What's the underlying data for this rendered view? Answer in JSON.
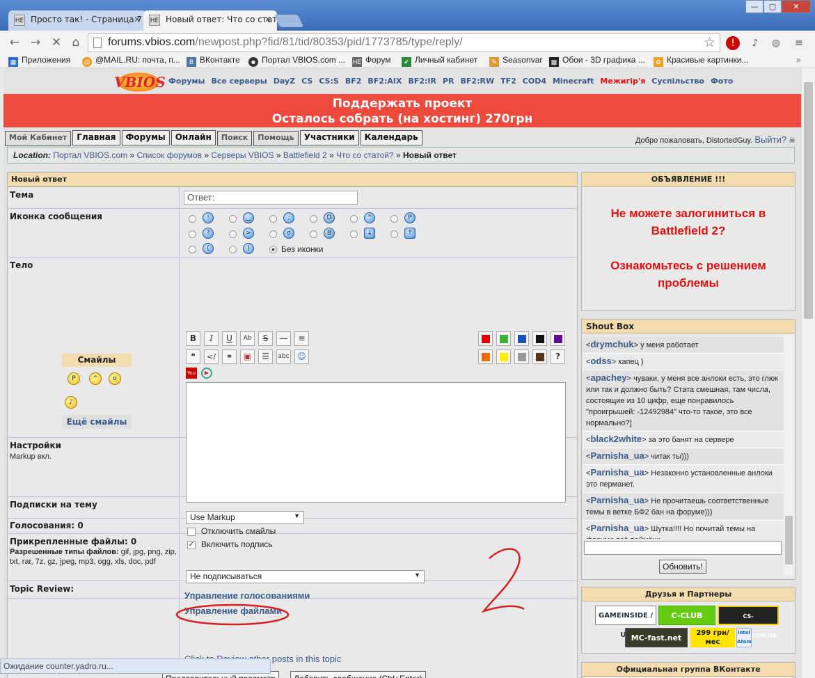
{
  "browser": {
    "tabs": [
      {
        "label": "Просто так! - Страница 7",
        "favicon": "НЕ"
      },
      {
        "label": "Новый ответ: Что со стат",
        "favicon": "НЕ"
      }
    ],
    "url_host": "forums.vbios.com",
    "url_path": "/newpost.php?fid/81/tid/80353/pid/1773785/type/reply/",
    "bookmarks": [
      "Приложения",
      "@MAIL.RU: почта, п...",
      "ВКонтакте",
      "Портал VBIOS.com ...",
      "Форум",
      "Личный кабинет",
      "Seasonvar",
      "Обои - 3D графика ...",
      "Красивые картинки..."
    ],
    "status": "Ожидание counter.yadro.ru..."
  },
  "site": {
    "logo": "VBIOS",
    "nav": [
      "Форумы",
      "Все серверы",
      "DayZ",
      "CS",
      "CS:S",
      "BF2",
      "BF2:AIX",
      "BF2:IR",
      "PR",
      "BF2:RW",
      "TF2",
      "COD4",
      "Minecraft",
      "Межигір'я",
      "Суспільство",
      "Фото"
    ],
    "banner_line1": "Поддержать проект",
    "banner_line2": "Осталось собрать (на хостинг) 270грн",
    "main_nav": [
      "Мой Кабинет",
      "Главная",
      "Форумы",
      "Онлайн",
      "Поиск",
      "Помощь",
      "Участники",
      "Календарь"
    ],
    "welcome": "Добро пожаловать, DistortedGuy.",
    "logout": "Выйти?",
    "location_label": "Location:",
    "crumbs": [
      "Портал VBIOS.com",
      "Список форумов",
      "Серверы VBIOS",
      "Battlefield 2",
      "Что со статой?"
    ],
    "crumb_current": "Новый ответ"
  },
  "form": {
    "header": "Новый ответ",
    "subject_label": "Тема",
    "subject_value": "Ответ:",
    "icon_label": "Иконка сообщения",
    "no_icon": "Без иконки",
    "body_label": "Тело",
    "smiles_title": "Смайлы",
    "more_smiles": "Ещё смайлы",
    "settings_label": "Настройки",
    "markup_on": "Markup вкл.",
    "markup_select": "Use Markup",
    "disable_smiles": "Отключить смайлы",
    "enable_signature": "Включить подпись",
    "subscribe_label": "Подписки на тему",
    "subscribe_select": "Не подписываться",
    "polls_label": "Голосования: 0",
    "polls_link": "Управление голосованиями",
    "files_label": "Прикрепленные файлы: 0",
    "files_types_label": "Разрешенные типы файлов:",
    "files_types": "gif, jpg, png, zip, txt, rar, 7z, gz, jpeg, mp3, ogg, xls, doc, pdf",
    "files_link": "Управление файлами",
    "review_label": "Topic Review:",
    "review_link": "Click to Review other posts in this topic",
    "preview_button": "Предварительный просмотр",
    "submit_button": "Добавить сообщение (Ctrl+Enter)",
    "colors": [
      "#e00000",
      "#3cb034",
      "#1e4fb8",
      "#111111",
      "#5a1090",
      "#f06a00",
      "#ffee00",
      "#999999",
      "#5a3416"
    ],
    "annotation": "2"
  },
  "announcement": {
    "title": "ОБЪЯВЛЕНИЕ !!!",
    "line1": "Не можете залогиниться в Battlefield 2?",
    "line2": "Ознакомьтесь с решением проблемы"
  },
  "shoutbox": {
    "title": "Shout Box",
    "messages": [
      {
        "user": "drymchuk",
        "text": "у меня работает"
      },
      {
        "user": "odss",
        "text": "капец )"
      },
      {
        "user": "apachey",
        "text": "чуваки, у меня все анлоки есть, это глюк или так и должно быть? Стата смешная, там числа, состоящие из 10 цифр, еще понравилось \"проигрышей: -12492984\" что-то такое, это все нормально?]"
      },
      {
        "user": "black2white",
        "text": "за это банят на сервере"
      },
      {
        "user": "Parnisha_ua",
        "text": "читак ты)))"
      },
      {
        "user": "Parnisha_ua",
        "text": "Незаконно установленные анлоки это перманет."
      },
      {
        "user": "Parnisha_ua",
        "text": "Не прочитаешь соответственные темы в ветке БФ2 бан на форуме)))"
      },
      {
        "user": "Parnisha_ua",
        "text": "Шутка!!!! Но почитай темы на форуме всё поймёшь"
      }
    ],
    "refresh": "Обновить!"
  },
  "partners": {
    "title": "Друзья и Партнеры",
    "items": [
      "GAMEINSIDE / UA",
      "C-CLUB",
      "CS-MAPPING.COM.UA",
      "MC-fast.net",
      "299 грн/мес",
      "intel Atom"
    ]
  },
  "vk_group": "Официальная группа ВКонтакте"
}
